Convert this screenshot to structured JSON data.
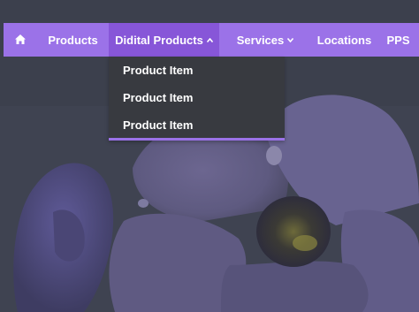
{
  "nav": {
    "home_icon": "home-icon",
    "items": [
      {
        "label": "Products"
      },
      {
        "label": "Didital Products"
      },
      {
        "label": "Services"
      },
      {
        "label": "Locations"
      },
      {
        "label": "PPS"
      }
    ]
  },
  "dropdown": {
    "items": [
      {
        "label": "Product Item"
      },
      {
        "label": "Product Item"
      },
      {
        "label": "Product Item"
      }
    ]
  },
  "colors": {
    "nav_bg": "#9b72e8",
    "nav_active_bg": "#8756d8",
    "dropdown_bg": "#383a40",
    "page_bg": "#3e4250"
  }
}
